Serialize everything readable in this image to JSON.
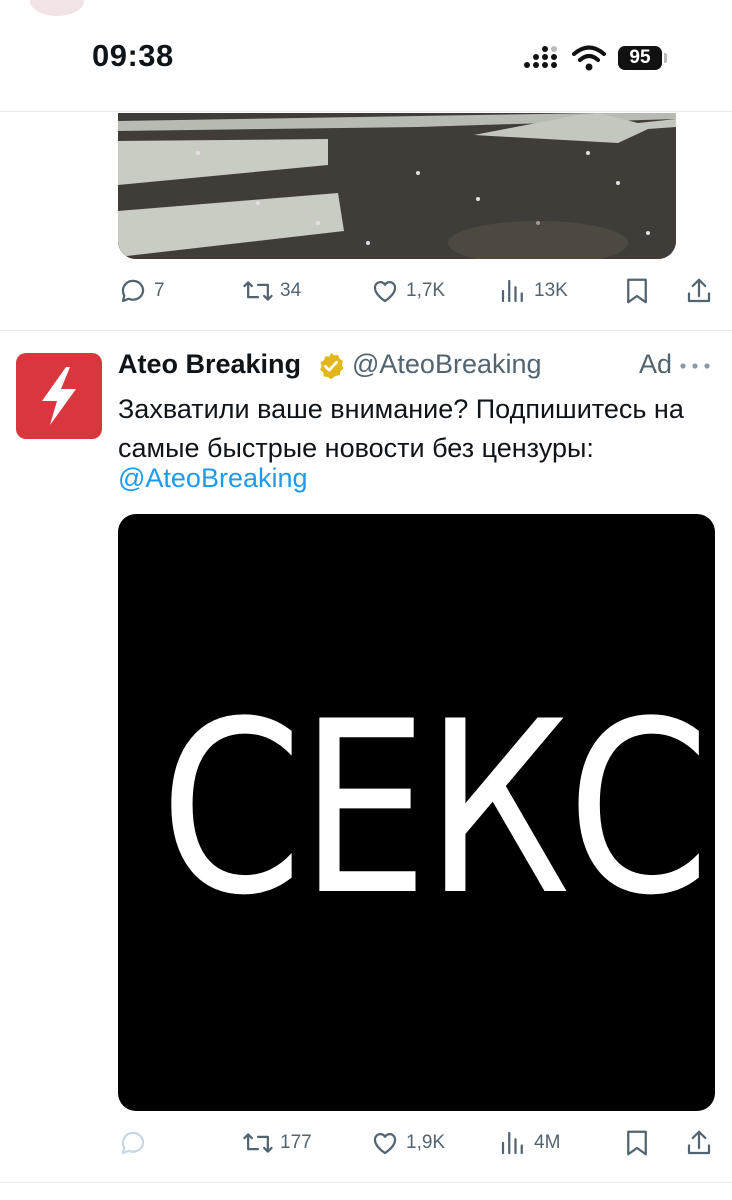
{
  "status_bar": {
    "time": "09:38",
    "battery": "95",
    "icons": [
      "signal-icon",
      "wifi-icon",
      "battery-icon"
    ]
  },
  "previous_tweet": {
    "replies": "7",
    "retweets": "34",
    "likes": "1,7K",
    "views": "13K"
  },
  "ad_tweet": {
    "author_name": "Ateo Breaking",
    "handle": "@AteoBreaking",
    "ad_label": "Ad",
    "text": "Захватили ваше внимание? Подпишитесь на самые быстрые новости без цензуры:",
    "mention": "@AteoBreaking",
    "media_text": "СЕКС",
    "retweets": "177",
    "likes": "1,9K",
    "views": "4M"
  },
  "colors": {
    "accent": "#1d9bf0",
    "muted": "#536471",
    "avatar": "#d9363e",
    "verified": "#e2b719"
  }
}
